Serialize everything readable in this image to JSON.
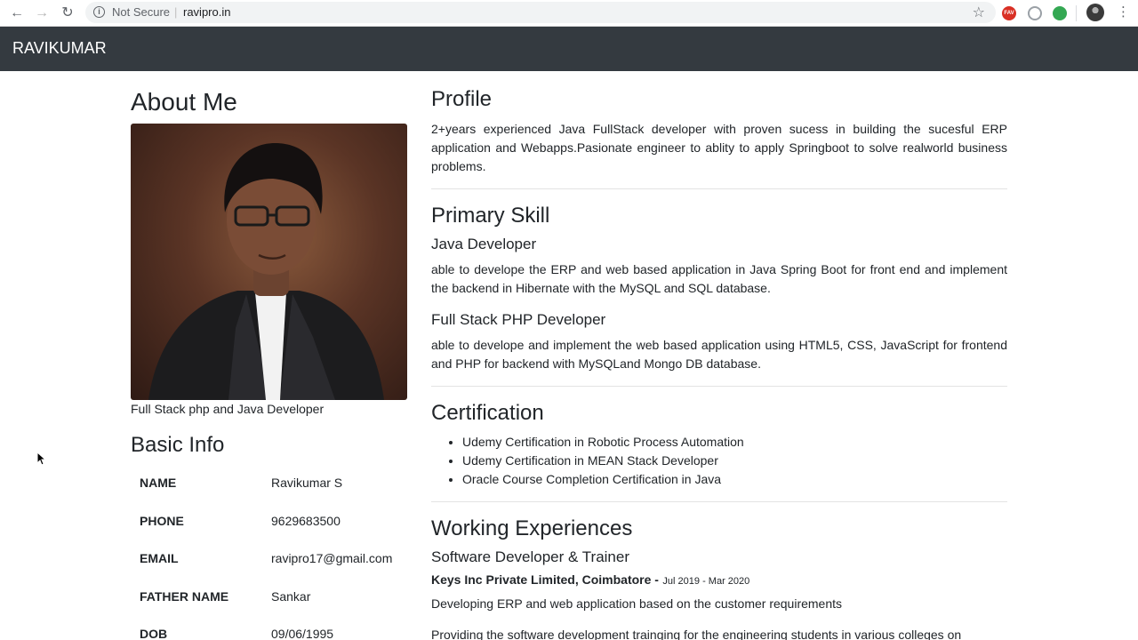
{
  "browser": {
    "security_label": "Not Secure",
    "url": "ravipro.in",
    "extensions": [
      {
        "name": "extension-red-icon",
        "text": "FAV",
        "color": "#d93025"
      },
      {
        "name": "extension-gray-icon",
        "text": "",
        "color": "#9aa0a6"
      },
      {
        "name": "extension-green-icon",
        "text": "",
        "color": "#34a853"
      }
    ]
  },
  "navbar": {
    "brand": "RAVIKUMAR"
  },
  "about": {
    "heading": "About Me",
    "caption": "Full Stack php and Java Developer"
  },
  "basic_info": {
    "heading": "Basic Info",
    "rows": [
      {
        "label": "NAME",
        "value": "Ravikumar S"
      },
      {
        "label": "PHONE",
        "value": "9629683500"
      },
      {
        "label": "EMAIL",
        "value": "ravipro17@gmail.com"
      },
      {
        "label": "FATHER NAME",
        "value": "Sankar"
      },
      {
        "label": "DOB",
        "value": "09/06/1995"
      }
    ]
  },
  "profile": {
    "heading": "Profile",
    "text": "2+years experienced Java FullStack developer with proven sucess in building the sucesful ERP application and Webapps.Pasionate engineer to ablity to apply Springboot to solve realworld business problems."
  },
  "primary_skill": {
    "heading": "Primary Skill",
    "skills": [
      {
        "title": "Java Developer",
        "text": "able to develope the ERP and web based application in Java Spring Boot for front end and implement the backend in Hibernate with the MySQL and SQL database."
      },
      {
        "title": "Full Stack PHP Developer",
        "text": "able to develope and implement the web based application using HTML5, CSS, JavaScript for frontend and PHP for backend with MySQLand Mongo DB database."
      }
    ]
  },
  "certification": {
    "heading": "Certification",
    "items": [
      "Udemy Certification in Robotic Process Automation",
      "Udemy Certification in MEAN Stack Developer",
      "Oracle Course Completion Certification in Java"
    ]
  },
  "experience": {
    "heading": "Working Experiences",
    "role": "Software Developer & Trainer",
    "company": "Keys Inc Private Limited, Coimbatore -",
    "dates": "Jul 2019 - Mar 2020",
    "points": [
      "Developing ERP and web application based on the customer requirements",
      "Providing the software development trainging for the engineering students in various colleges on"
    ]
  }
}
